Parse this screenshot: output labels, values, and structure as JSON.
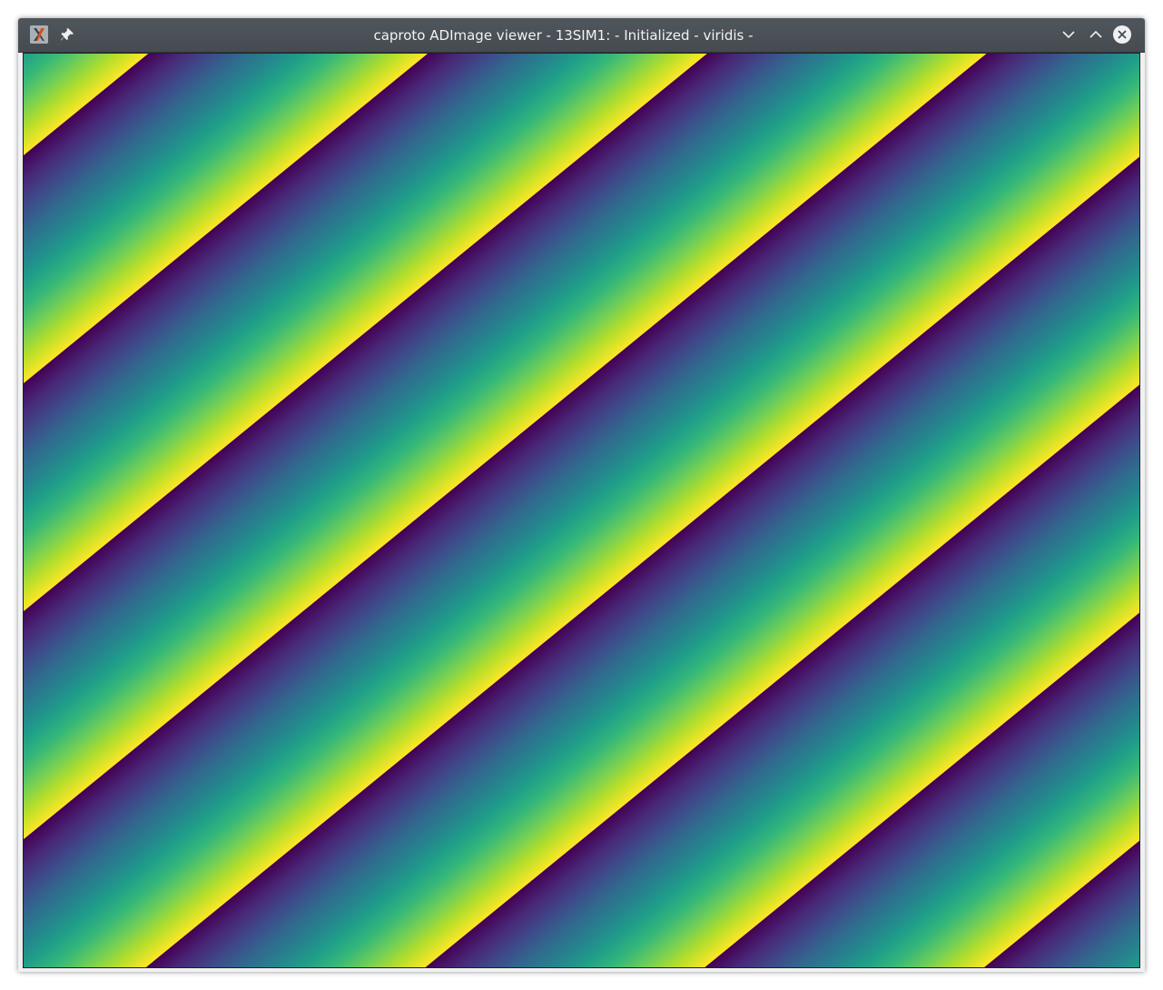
{
  "window": {
    "title": "caproto ADImage viewer - 13SIM1: - Initialized - viridis -"
  },
  "titlebar": {
    "icons": {
      "app": "x-app-icon",
      "pin": "pin-icon",
      "minimize": "chevron-down-icon",
      "maximize": "chevron-up-icon",
      "close": "close-circle-icon"
    }
  },
  "viewer": {
    "colormap": "viridis",
    "colormap_stops": [
      "#440154",
      "#482878",
      "#3e4989",
      "#31688e",
      "#26828e",
      "#1f9e89",
      "#35b779",
      "#6ece58",
      "#b5de2b",
      "#fde725"
    ]
  }
}
